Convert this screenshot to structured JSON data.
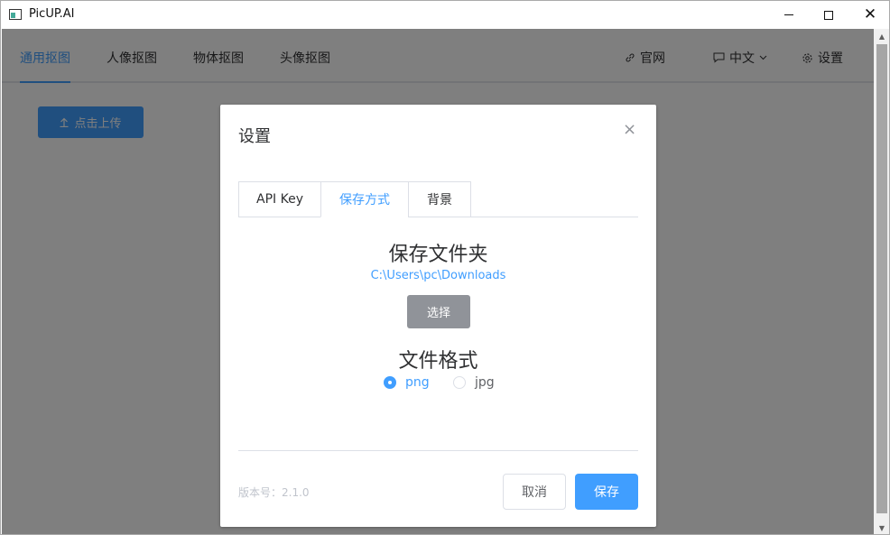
{
  "window": {
    "title": "PicUP.AI",
    "min_icon": "minimize-icon",
    "max_icon": "maximize-icon",
    "close_glyph": "✕"
  },
  "nav": {
    "tabs": [
      {
        "label": "通用抠图",
        "active": true
      },
      {
        "label": "人像抠图",
        "active": false
      },
      {
        "label": "物体抠图",
        "active": false
      },
      {
        "label": "头像抠图",
        "active": false
      }
    ],
    "website_label": "官网",
    "language_label": "中文",
    "settings_label": "设置"
  },
  "upload_button": {
    "label": "点击上传",
    "icon": "upload-icon"
  },
  "dialog": {
    "title": "设置",
    "close_glyph": "×",
    "tabs": [
      {
        "label": "API Key",
        "active": false
      },
      {
        "label": "保存方式",
        "active": true
      },
      {
        "label": "背景",
        "active": false
      }
    ],
    "save_folder_title": "保存文件夹",
    "save_folder_path": "C:\\Users\\pc\\Downloads",
    "choose_label": "选择",
    "file_format_title": "文件格式",
    "formats": [
      {
        "label": "png",
        "checked": true
      },
      {
        "label": "jpg",
        "checked": false
      }
    ],
    "version_text": "版本号：2.1.0",
    "cancel_label": "取消",
    "save_label": "保存"
  },
  "colors": {
    "accent": "#409eff",
    "overlay": "rgba(0,0,0,0.5)",
    "muted_button": "#909399"
  }
}
